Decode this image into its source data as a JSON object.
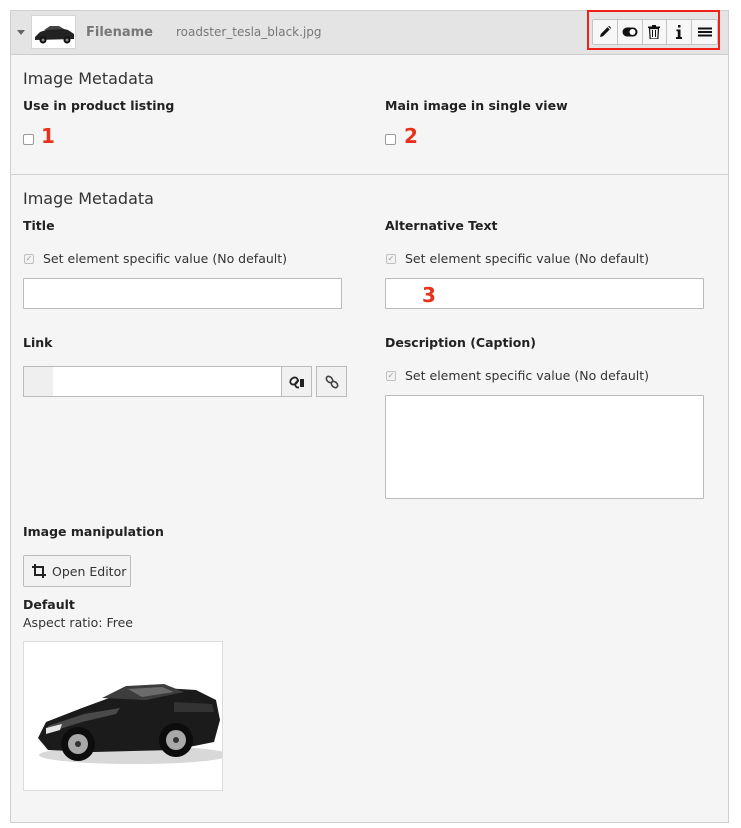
{
  "header": {
    "filename_label": "Filename",
    "filename_value": "roadster_tesla_black.jpg",
    "toolbar": {
      "items": [
        "edit-icon",
        "toggle-icon",
        "delete-icon",
        "info-icon",
        "menu-icon"
      ]
    }
  },
  "palette": {
    "accent": "#f0201a",
    "marker": "#e8321e"
  },
  "section1": {
    "title": "Image Metadata",
    "fields": [
      {
        "label": "Use in product listing",
        "checked": false,
        "marker": "1"
      },
      {
        "label": "Main image in single view",
        "checked": false,
        "marker": "2"
      }
    ]
  },
  "section2": {
    "title": "Image Metadata",
    "title_field": {
      "label": "Title",
      "override_text": "Set element specific value (No default)",
      "value": ""
    },
    "alt_field": {
      "label": "Alternative Text",
      "override_text": "Set element specific value (No default)",
      "value": "",
      "marker": "3"
    },
    "link_field": {
      "label": "Link",
      "value": ""
    },
    "description_field": {
      "label": "Description (Caption)",
      "override_text": "Set element specific value (No default)",
      "value": ""
    },
    "image_manipulation": {
      "label": "Image manipulation",
      "button_label": "Open Editor",
      "crop_name": "Default",
      "aspect_ratio": "Aspect ratio: Free"
    }
  }
}
